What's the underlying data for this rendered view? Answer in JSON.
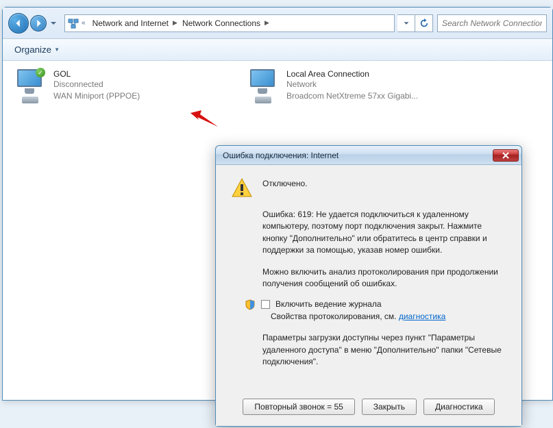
{
  "explorer": {
    "breadcrumb": {
      "seg1": "Network and Internet",
      "seg2": "Network Connections"
    },
    "search_placeholder": "Search Network Connections",
    "toolbar": {
      "organize": "Organize"
    }
  },
  "connections": [
    {
      "title": "GOL",
      "status": "Disconnected",
      "device": "WAN Miniport (PPPOE)"
    },
    {
      "title": "Local Area Connection",
      "status": "Network",
      "device": "Broadcom NetXtreme 57xx Gigabi..."
    }
  ],
  "dialog": {
    "title": "Ошибка подключения: Internet",
    "disconnected": "Отключено.",
    "error_text": "Ошибка: 619: Не удается подключиться к удаленному компьютеру, поэтому порт подключения закрыт. Нажмите кнопку \"Дополнительно\" или обратитесь в центр справки и поддержки за помощью, указав номер ошибки.",
    "logging_text": "Можно включить анализ протоколирования при продолжении получения сообщений об ошибках.",
    "checkbox_label": "Включить ведение журнала",
    "link_prefix": "Свойства протоколирования, см. ",
    "link_text": "диагностика",
    "params_text": "Параметры загрузки доступны через пункт \"Параметры удаленного доступа\" в меню \"Дополнительно\" папки \"Сетевые подключения\".",
    "buttons": {
      "redial": "Повторный звонок = 55",
      "close": "Закрыть",
      "diagnostics": "Диагностика"
    }
  }
}
